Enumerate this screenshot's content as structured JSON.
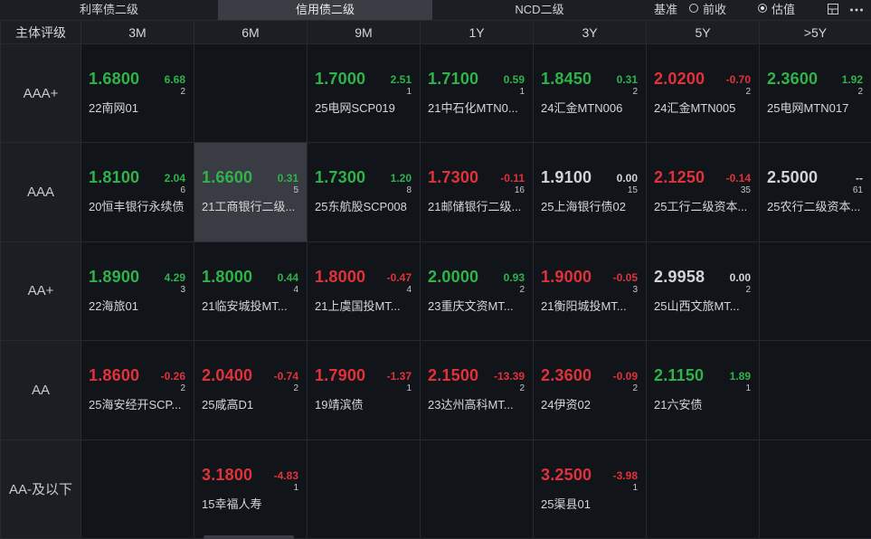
{
  "tabs": [
    {
      "label": "利率债二级",
      "active": false
    },
    {
      "label": "信用债二级",
      "active": true
    },
    {
      "label": "NCD二级",
      "active": false
    }
  ],
  "benchmark": {
    "label": "基准",
    "options": [
      {
        "label": "前收",
        "selected": false
      },
      {
        "label": "估值",
        "selected": true
      }
    ]
  },
  "toolbar_icons": [
    "layout-icon",
    "more-icon"
  ],
  "table": {
    "corner": "主体评级",
    "columns": [
      "3M",
      "6M",
      "9M",
      "1Y",
      "3Y",
      "5Y",
      ">5Y"
    ],
    "rows": [
      {
        "rating": "AAA+",
        "cells": [
          {
            "rate": "1.6800",
            "change": "6.68",
            "count": "2",
            "bond": "22南网01",
            "color": "g"
          },
          null,
          {
            "rate": "1.7000",
            "change": "2.51",
            "count": "1",
            "bond": "25电网SCP019",
            "color": "g"
          },
          {
            "rate": "1.7100",
            "change": "0.59",
            "count": "1",
            "bond": "21中石化MTN0...",
            "color": "g"
          },
          {
            "rate": "1.8450",
            "change": "0.31",
            "count": "2",
            "bond": "24汇金MTN006",
            "color": "g"
          },
          {
            "rate": "2.0200",
            "change": "-0.70",
            "count": "2",
            "bond": "24汇金MTN005",
            "color": "r"
          },
          {
            "rate": "2.3600",
            "change": "1.92",
            "count": "2",
            "bond": "25电网MTN017",
            "color": "g"
          }
        ]
      },
      {
        "rating": "AAA",
        "cells": [
          {
            "rate": "1.8100",
            "change": "2.04",
            "count": "6",
            "bond": "20恒丰银行永续债",
            "color": "g"
          },
          {
            "rate": "1.6600",
            "change": "0.31",
            "count": "5",
            "bond": "21工商银行二级...",
            "color": "g",
            "selected": true
          },
          {
            "rate": "1.7300",
            "change": "1.20",
            "count": "8",
            "bond": "25东航股SCP008",
            "color": "g"
          },
          {
            "rate": "1.7300",
            "change": "-0.11",
            "count": "16",
            "bond": "21邮储银行二级...",
            "color": "r"
          },
          {
            "rate": "1.9100",
            "change": "0.00",
            "count": "15",
            "bond": "25上海银行债02",
            "color": "w"
          },
          {
            "rate": "2.1250",
            "change": "-0.14",
            "count": "35",
            "bond": "25工行二级资本...",
            "color": "r"
          },
          {
            "rate": "2.5000",
            "change": "--",
            "count": "61",
            "bond": "25农行二级资本...",
            "color": "w"
          }
        ]
      },
      {
        "rating": "AA+",
        "cells": [
          {
            "rate": "1.8900",
            "change": "4.29",
            "count": "3",
            "bond": "22海旅01",
            "color": "g"
          },
          {
            "rate": "1.8000",
            "change": "0.44",
            "count": "4",
            "bond": "21临安城投MT...",
            "color": "g"
          },
          {
            "rate": "1.8000",
            "change": "-0.47",
            "count": "4",
            "bond": "21上虞国投MT...",
            "color": "r"
          },
          {
            "rate": "2.0000",
            "change": "0.93",
            "count": "2",
            "bond": "23重庆文资MT...",
            "color": "g"
          },
          {
            "rate": "1.9000",
            "change": "-0.05",
            "count": "3",
            "bond": "21衡阳城投MT...",
            "color": "r"
          },
          {
            "rate": "2.9958",
            "change": "0.00",
            "count": "2",
            "bond": "25山西文旅MT...",
            "color": "w"
          },
          null
        ]
      },
      {
        "rating": "AA",
        "cells": [
          {
            "rate": "1.8600",
            "change": "-0.26",
            "count": "2",
            "bond": "25海安经开SCP...",
            "color": "r"
          },
          {
            "rate": "2.0400",
            "change": "-0.74",
            "count": "2",
            "bond": "25咸高D1",
            "color": "r"
          },
          {
            "rate": "1.7900",
            "change": "-1.37",
            "count": "1",
            "bond": "19靖滨债",
            "color": "r"
          },
          {
            "rate": "2.1500",
            "change": "-13.39",
            "count": "2",
            "bond": "23达州高科MT...",
            "color": "r"
          },
          {
            "rate": "2.3600",
            "change": "-0.09",
            "count": "2",
            "bond": "24伊资02",
            "color": "r"
          },
          {
            "rate": "2.1150",
            "change": "1.89",
            "count": "1",
            "bond": "21六安债",
            "color": "g"
          },
          null
        ]
      },
      {
        "rating": "AA-及以下",
        "cells": [
          null,
          {
            "rate": "3.1800",
            "change": "-4.83",
            "count": "1",
            "bond": "15幸福人寿",
            "color": "r"
          },
          null,
          null,
          {
            "rate": "3.2500",
            "change": "-3.98",
            "count": "1",
            "bond": "25渠县01",
            "color": "r"
          },
          null,
          null
        ]
      }
    ]
  }
}
